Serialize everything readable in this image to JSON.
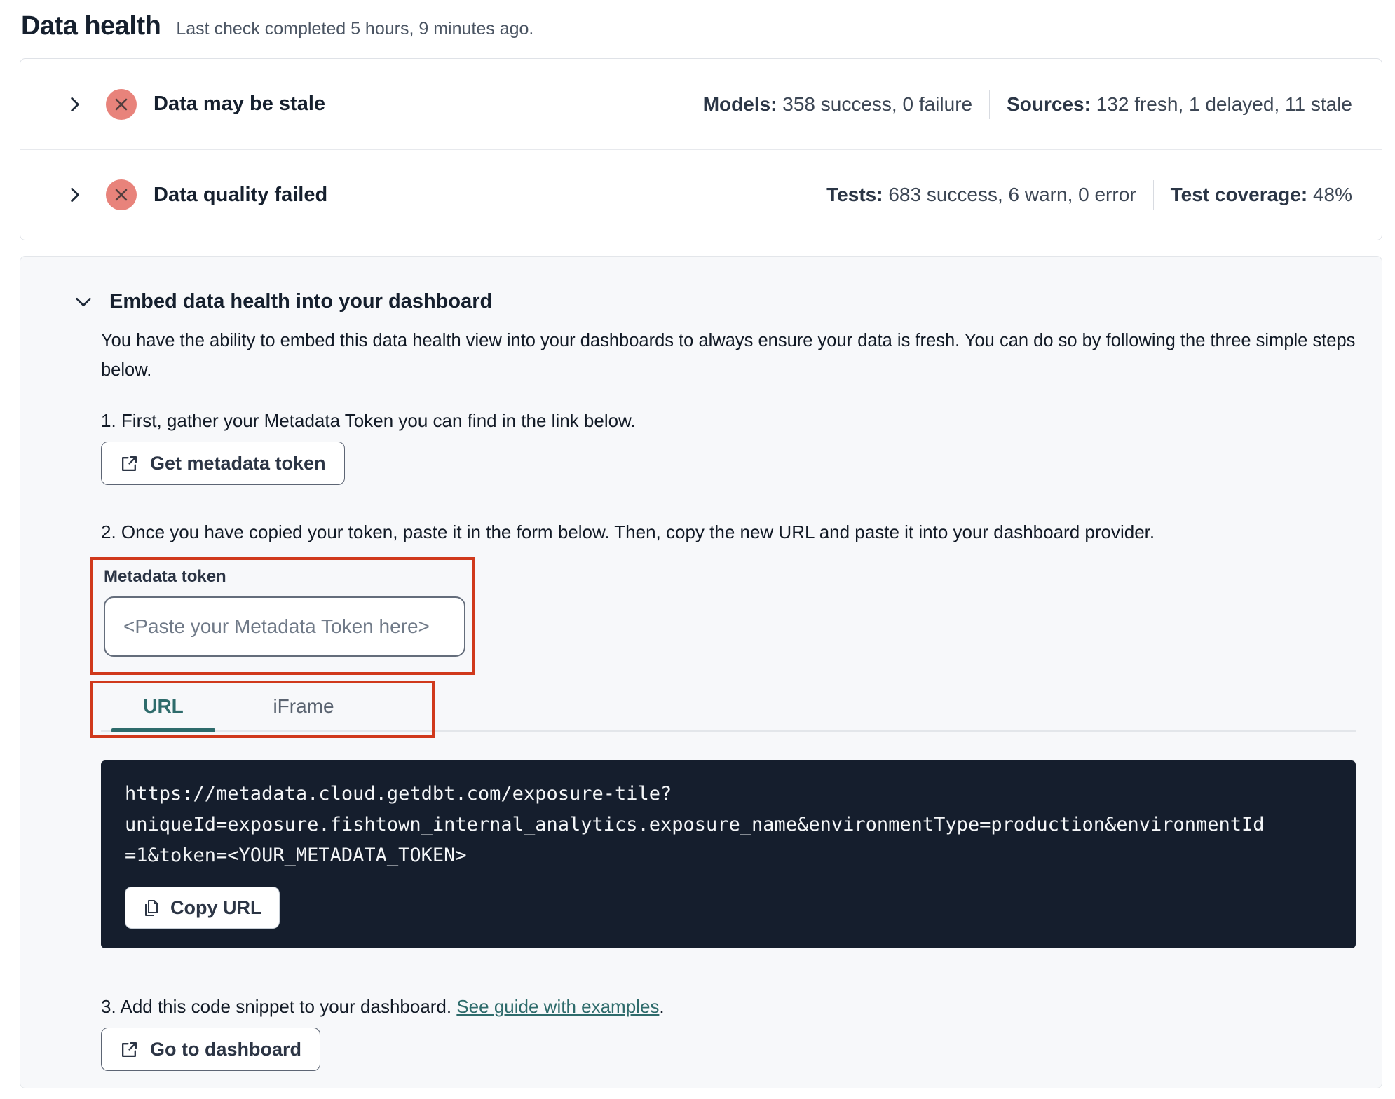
{
  "page": {
    "title": "Data health",
    "subtitle": "Last check completed 5 hours, 9 minutes ago."
  },
  "status_rows": [
    {
      "title": "Data may be stale",
      "status_icon": "error-x-circle",
      "stats": [
        {
          "label": "Models:",
          "value": "358 success, 0 failure"
        },
        {
          "label": "Sources:",
          "value": "132 fresh, 1 delayed, 11 stale"
        }
      ]
    },
    {
      "title": "Data quality failed",
      "status_icon": "error-x-circle",
      "stats": [
        {
          "label": "Tests:",
          "value": "683 success, 6 warn, 0 error"
        },
        {
          "label": "Test coverage:",
          "value": "48%"
        }
      ]
    }
  ],
  "embed": {
    "title": "Embed data health into your dashboard",
    "description": "You have the ability to embed this data health view into your dashboards to always ensure your data is fresh. You can do so by following the three simple steps below.",
    "step1": "1. First, gather your Metadata Token you can find in the link below.",
    "get_token_button": "Get metadata token",
    "step2": "2. Once you have copied your token, paste it in the form below. Then, copy the new URL and paste it into your dashboard provider.",
    "token_label": "Metadata token",
    "token_placeholder": "<Paste your Metadata Token here>",
    "tabs": [
      {
        "label": "URL",
        "active": true
      },
      {
        "label": "iFrame",
        "active": false
      }
    ],
    "code_url": "https://metadata.cloud.getdbt.com/exposure-tile?uniqueId=exposure.fishtown_internal_analytics.exposure_name&environmentType=production&environmentId=1&token=<YOUR_METADATA_TOKEN>",
    "code_lines": [
      "https://metadata.cloud.getdbt.com/exposure-tile?",
      "uniqueId=exposure.fishtown_internal_analytics.exposure_name&environmentType=production&environmentId",
      "=1&token=<YOUR_METADATA_TOKEN>"
    ],
    "copy_button": "Copy URL",
    "step3_prefix": "3. Add this code snippet to your dashboard. ",
    "step3_link": "See guide with examples",
    "step3_suffix": ".",
    "dashboard_button": "Go to dashboard"
  },
  "colors": {
    "annotation_red": "#d0391c",
    "status_error_bg": "#e8837b",
    "status_error_glyph": "#523f3f",
    "accent_teal": "#2e6b6b",
    "code_background": "#151e2d",
    "card_background": "#f7f8fa"
  }
}
